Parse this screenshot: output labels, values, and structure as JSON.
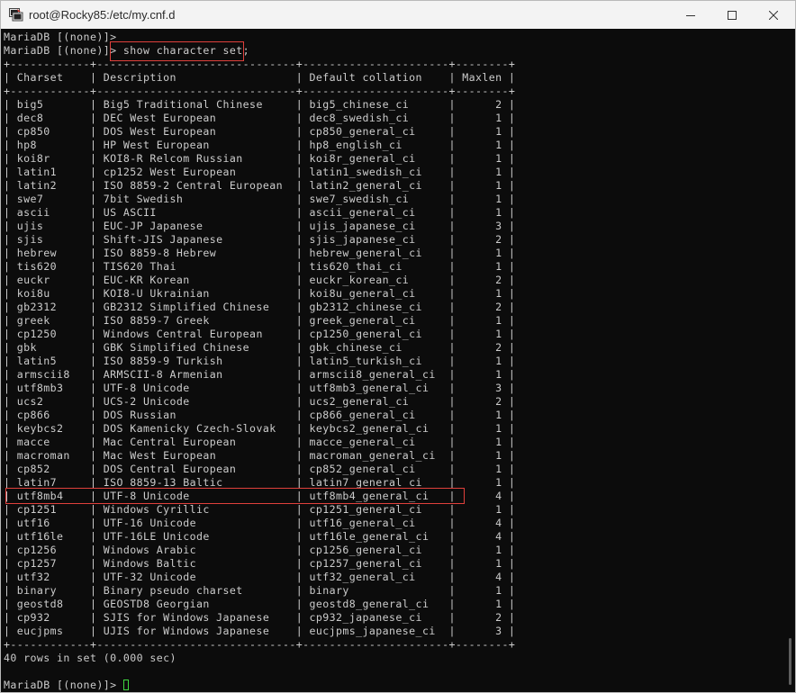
{
  "window": {
    "title": "root@Rocky85:/etc/my.cnf.d",
    "icon": "putty-terminal-icon"
  },
  "controls": {
    "minimize": "minimize-icon",
    "maximize": "maximize-icon",
    "close": "close-icon"
  },
  "terminal": {
    "prompt": "MariaDB [(none)]>",
    "command": "show character set;",
    "columns": [
      "Charset",
      "Description",
      "Default collation",
      "Maxlen"
    ],
    "rows": [
      [
        "big5",
        "Big5 Traditional Chinese",
        "big5_chinese_ci",
        "2"
      ],
      [
        "dec8",
        "DEC West European",
        "dec8_swedish_ci",
        "1"
      ],
      [
        "cp850",
        "DOS West European",
        "cp850_general_ci",
        "1"
      ],
      [
        "hp8",
        "HP West European",
        "hp8_english_ci",
        "1"
      ],
      [
        "koi8r",
        "KOI8-R Relcom Russian",
        "koi8r_general_ci",
        "1"
      ],
      [
        "latin1",
        "cp1252 West European",
        "latin1_swedish_ci",
        "1"
      ],
      [
        "latin2",
        "ISO 8859-2 Central European",
        "latin2_general_ci",
        "1"
      ],
      [
        "swe7",
        "7bit Swedish",
        "swe7_swedish_ci",
        "1"
      ],
      [
        "ascii",
        "US ASCII",
        "ascii_general_ci",
        "1"
      ],
      [
        "ujis",
        "EUC-JP Japanese",
        "ujis_japanese_ci",
        "3"
      ],
      [
        "sjis",
        "Shift-JIS Japanese",
        "sjis_japanese_ci",
        "2"
      ],
      [
        "hebrew",
        "ISO 8859-8 Hebrew",
        "hebrew_general_ci",
        "1"
      ],
      [
        "tis620",
        "TIS620 Thai",
        "tis620_thai_ci",
        "1"
      ],
      [
        "euckr",
        "EUC-KR Korean",
        "euckr_korean_ci",
        "2"
      ],
      [
        "koi8u",
        "KOI8-U Ukrainian",
        "koi8u_general_ci",
        "1"
      ],
      [
        "gb2312",
        "GB2312 Simplified Chinese",
        "gb2312_chinese_ci",
        "2"
      ],
      [
        "greek",
        "ISO 8859-7 Greek",
        "greek_general_ci",
        "1"
      ],
      [
        "cp1250",
        "Windows Central European",
        "cp1250_general_ci",
        "1"
      ],
      [
        "gbk",
        "GBK Simplified Chinese",
        "gbk_chinese_ci",
        "2"
      ],
      [
        "latin5",
        "ISO 8859-9 Turkish",
        "latin5_turkish_ci",
        "1"
      ],
      [
        "armscii8",
        "ARMSCII-8 Armenian",
        "armscii8_general_ci",
        "1"
      ],
      [
        "utf8mb3",
        "UTF-8 Unicode",
        "utf8mb3_general_ci",
        "3"
      ],
      [
        "ucs2",
        "UCS-2 Unicode",
        "ucs2_general_ci",
        "2"
      ],
      [
        "cp866",
        "DOS Russian",
        "cp866_general_ci",
        "1"
      ],
      [
        "keybcs2",
        "DOS Kamenicky Czech-Slovak",
        "keybcs2_general_ci",
        "1"
      ],
      [
        "macce",
        "Mac Central European",
        "macce_general_ci",
        "1"
      ],
      [
        "macroman",
        "Mac West European",
        "macroman_general_ci",
        "1"
      ],
      [
        "cp852",
        "DOS Central European",
        "cp852_general_ci",
        "1"
      ],
      [
        "latin7",
        "ISO 8859-13 Baltic",
        "latin7_general_ci",
        "1"
      ],
      [
        "utf8mb4",
        "UTF-8 Unicode",
        "utf8mb4_general_ci",
        "4"
      ],
      [
        "cp1251",
        "Windows Cyrillic",
        "cp1251_general_ci",
        "1"
      ],
      [
        "utf16",
        "UTF-16 Unicode",
        "utf16_general_ci",
        "4"
      ],
      [
        "utf16le",
        "UTF-16LE Unicode",
        "utf16le_general_ci",
        "4"
      ],
      [
        "cp1256",
        "Windows Arabic",
        "cp1256_general_ci",
        "1"
      ],
      [
        "cp1257",
        "Windows Baltic",
        "cp1257_general_ci",
        "1"
      ],
      [
        "utf32",
        "UTF-32 Unicode",
        "utf32_general_ci",
        "4"
      ],
      [
        "binary",
        "Binary pseudo charset",
        "binary",
        "1"
      ],
      [
        "geostd8",
        "GEOSTD8 Georgian",
        "geostd8_general_ci",
        "1"
      ],
      [
        "cp932",
        "SJIS for Windows Japanese",
        "cp932_japanese_ci",
        "2"
      ],
      [
        "eucjpms",
        "UJIS for Windows Japanese",
        "eucjpms_japanese_ci",
        "3"
      ]
    ],
    "highlighted_charset": "utf8mb4",
    "summary": "40 rows in set (0.000 sec)"
  },
  "colors": {
    "terminal_bg": "#0c0c0c",
    "terminal_fg": "#cccccc",
    "highlight": "#e0403c",
    "cursor": "#3fd83f"
  }
}
